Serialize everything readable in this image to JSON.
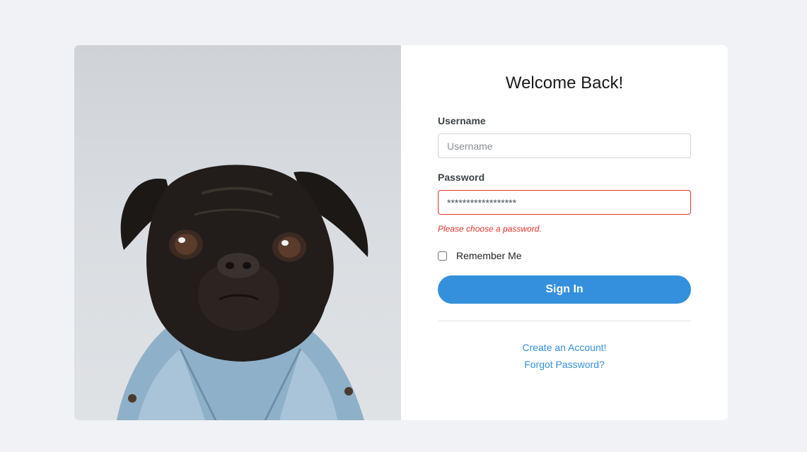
{
  "form": {
    "title": "Welcome Back!",
    "username_label": "Username",
    "username_placeholder": "Username",
    "username_value": "",
    "password_label": "Password",
    "password_value": "******************",
    "password_error": "Please choose a password.",
    "remember_label": "Remember Me",
    "remember_checked": false,
    "signin_label": "Sign In",
    "create_account_link": "Create an Account!",
    "forgot_password_link": "Forgot Password?"
  },
  "colors": {
    "primary": "#3490dc",
    "error": "#e3342f",
    "background": "#f0f2f5"
  }
}
